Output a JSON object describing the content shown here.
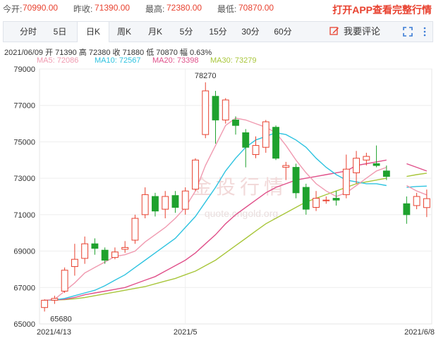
{
  "quote": {
    "current_label": "今开:",
    "current_value": "70990.00",
    "prev_close_label": "昨收:",
    "prev_close_value": "71390.00",
    "high_label": "最高:",
    "high_value": "72380.00",
    "low_label": "最低:",
    "low_value": "70870.00",
    "promo": "打开APP查看完整行情"
  },
  "toolbar": {
    "tabs": [
      "分时",
      "5日",
      "日K",
      "周K",
      "月K",
      "5分",
      "15分",
      "30分",
      "60分"
    ],
    "active_tab": "日K",
    "comment_label": "我要评论"
  },
  "info": "2021/06/09  开 71390  高 72380  收 71880  低 70870  幅 0.63%",
  "ma": {
    "ma5": "MA5: 72086",
    "ma10": "MA10: 72567",
    "ma20": "MA20: 73398",
    "ma30": "MA30: 73279",
    "colors": {
      "ma5": "#f09ab0",
      "ma10": "#2ec3e0",
      "ma20": "#e0508a",
      "ma30": "#a8c63a"
    }
  },
  "watermark": {
    "cn": "金投行情",
    "url": "quote.cngold.org"
  },
  "colors": {
    "up": "#e8412f",
    "down": "#1fa22e"
  },
  "chart_data": {
    "type": "candlestick",
    "ylim": [
      65000,
      79000
    ],
    "y_ticks": [
      "79000",
      "77000",
      "75000",
      "73000",
      "71000",
      "69000",
      "67000",
      "65000"
    ],
    "y_tick_values": [
      79000,
      77000,
      75000,
      73000,
      71000,
      69000,
      67000,
      65000
    ],
    "x_labels": [
      {
        "label": "2021/4/13",
        "index": 0
      },
      {
        "label": "2021/5",
        "index": 14
      },
      {
        "label": "2021/6/8",
        "index": 38
      }
    ],
    "annotations": [
      {
        "text": "78270",
        "index": 16,
        "value": 78270
      },
      {
        "text": "65680",
        "index": 0,
        "value": 65680
      }
    ],
    "candles": [
      [
        65900,
        66300,
        66350,
        65680
      ],
      [
        66300,
        66400,
        66550,
        66100
      ],
      [
        66800,
        67950,
        68100,
        66700
      ],
      [
        68150,
        68550,
        69400,
        67650
      ],
      [
        68600,
        69400,
        69800,
        68300
      ],
      [
        69400,
        69150,
        69700,
        68800
      ],
      [
        69050,
        68500,
        69200,
        68300
      ],
      [
        68650,
        68950,
        69200,
        68550
      ],
      [
        69100,
        69200,
        69550,
        68900
      ],
      [
        69600,
        70800,
        71000,
        69400
      ],
      [
        71000,
        72100,
        72500,
        70800
      ],
      [
        72000,
        71200,
        72200,
        70900
      ],
      [
        71300,
        72000,
        72300,
        70800
      ],
      [
        72050,
        71400,
        72300,
        71100
      ],
      [
        71300,
        72300,
        72500,
        71000
      ],
      [
        72400,
        74000,
        74100,
        72300
      ],
      [
        75400,
        77800,
        78270,
        75200
      ],
      [
        77500,
        76200,
        77800,
        74900
      ],
      [
        76200,
        77300,
        77400,
        76000
      ],
      [
        76200,
        75900,
        76400,
        75400
      ],
      [
        75500,
        74700,
        75700,
        73600
      ],
      [
        74300,
        74800,
        75300,
        74100
      ],
      [
        74700,
        76100,
        76200,
        74400
      ],
      [
        75800,
        74100,
        75900,
        74000
      ],
      [
        73600,
        73700,
        73900,
        72900
      ],
      [
        73600,
        72200,
        73800,
        71900
      ],
      [
        72500,
        71300,
        72700,
        71000
      ],
      [
        71400,
        71900,
        72300,
        71200
      ],
      [
        71800,
        71800,
        72000,
        71600
      ],
      [
        71900,
        71800,
        72300,
        71500
      ],
      [
        72100,
        73500,
        74300,
        71900
      ],
      [
        73300,
        74100,
        74500,
        72700
      ],
      [
        74000,
        74200,
        74400,
        73700
      ],
      [
        73800,
        73700,
        74800,
        73600
      ],
      [
        73400,
        73100,
        73700,
        72900
      ],
      [
        null,
        null,
        null,
        null
      ],
      [
        71600,
        71000,
        72000,
        70500
      ],
      [
        71500,
        72000,
        72200,
        71300
      ],
      [
        71390,
        71880,
        72380,
        70870
      ]
    ],
    "series": [
      {
        "name": "MA5",
        "values": [
          66300,
          66350,
          66800,
          67250,
          67800,
          68100,
          68400,
          68700,
          68800,
          69000,
          69500,
          69900,
          70300,
          70800,
          71400,
          72300,
          73700,
          74800,
          75900,
          76300,
          76200,
          76000,
          75800,
          75500,
          74800,
          74000,
          73300,
          72700,
          72300,
          72000,
          72200,
          72600,
          73000,
          73400,
          73600,
          null,
          72600,
          72300,
          72086
        ]
      },
      {
        "name": "MA10",
        "values": [
          66300,
          66320,
          66400,
          66550,
          66700,
          66850,
          67100,
          67400,
          67700,
          68100,
          68500,
          68900,
          69300,
          69700,
          70300,
          70900,
          71700,
          72500,
          73400,
          74100,
          74700,
          75100,
          75300,
          75500,
          75400,
          75100,
          74700,
          74100,
          73600,
          73200,
          72900,
          72800,
          72700,
          72700,
          72600,
          null,
          72500,
          72550,
          72567
        ]
      },
      {
        "name": "MA20",
        "values": [
          66300,
          66320,
          66350,
          66450,
          66600,
          66700,
          66800,
          66900,
          67000,
          67200,
          67400,
          67600,
          67900,
          68200,
          68500,
          68900,
          69400,
          69900,
          70500,
          71000,
          71400,
          71800,
          72200,
          72500,
          72700,
          72900,
          73000,
          73100,
          73200,
          73300,
          73400,
          73700,
          73800,
          73900,
          74000,
          null,
          73800,
          73600,
          73398
        ]
      },
      {
        "name": "MA30",
        "values": [
          66300,
          66310,
          66330,
          66380,
          66450,
          66550,
          66650,
          66750,
          66850,
          66950,
          67050,
          67200,
          67350,
          67500,
          67700,
          67900,
          68200,
          68500,
          68900,
          69300,
          69700,
          70100,
          70500,
          70800,
          71100,
          71400,
          71700,
          71900,
          72100,
          72300,
          72500,
          72700,
          72800,
          72900,
          73000,
          null,
          73100,
          73200,
          73279
        ]
      }
    ]
  }
}
